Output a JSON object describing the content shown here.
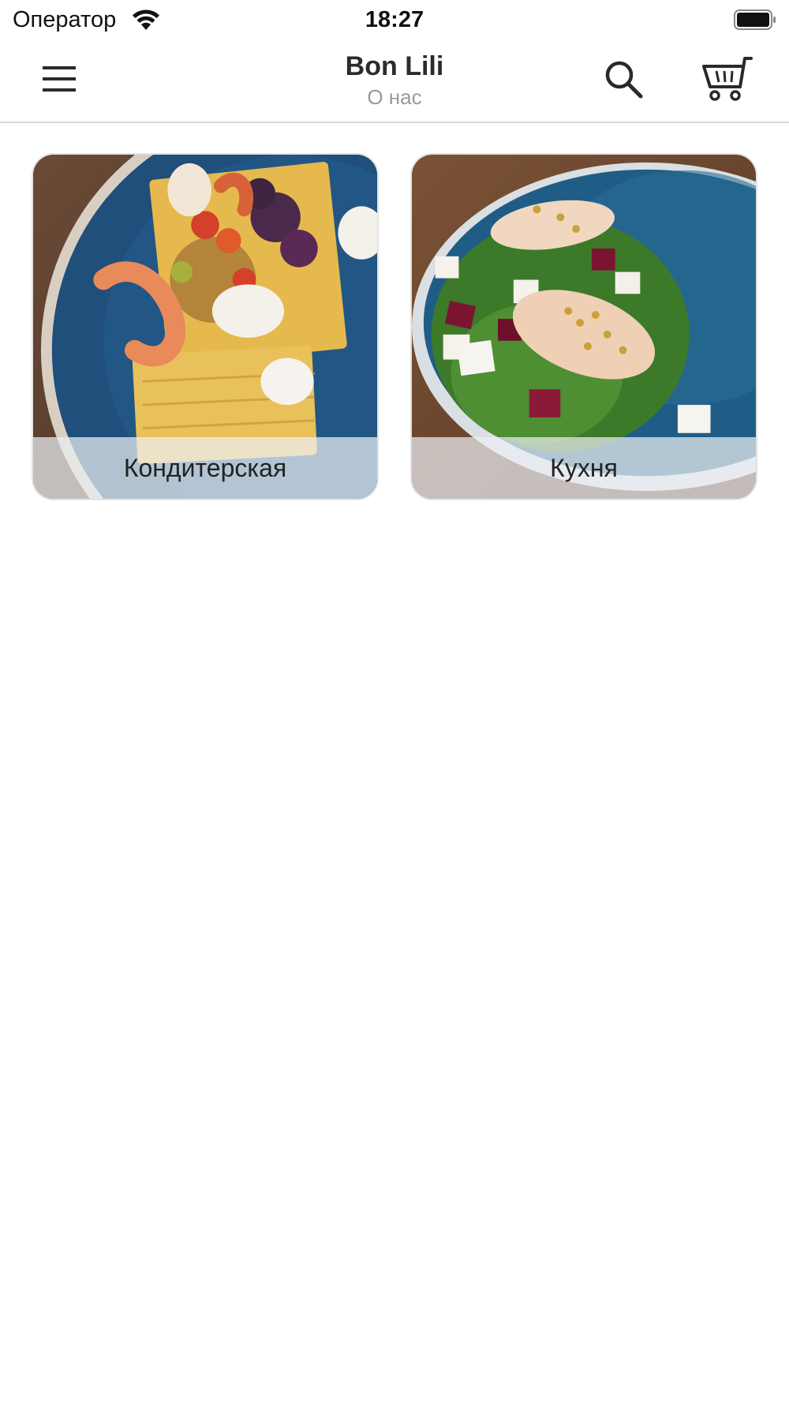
{
  "status_bar": {
    "carrier": "Оператор",
    "time": "18:27",
    "wifi_icon": "wifi-icon",
    "battery_icon": "battery-icon"
  },
  "nav": {
    "title": "Bon Lili",
    "subtitle": "О нас",
    "menu_icon": "hamburger-menu-icon",
    "search_icon": "search-icon",
    "cart_icon": "cart-icon"
  },
  "categories": [
    {
      "label": "Кондитерская",
      "image": "waffles-with-shrimp-photo"
    },
    {
      "label": "Кухня",
      "image": "salad-with-chicken-photo"
    }
  ],
  "colors": {
    "header_divider": "#d8d8d8",
    "subtitle": "#9a9a9a",
    "label_bar": "#ebeef2"
  }
}
